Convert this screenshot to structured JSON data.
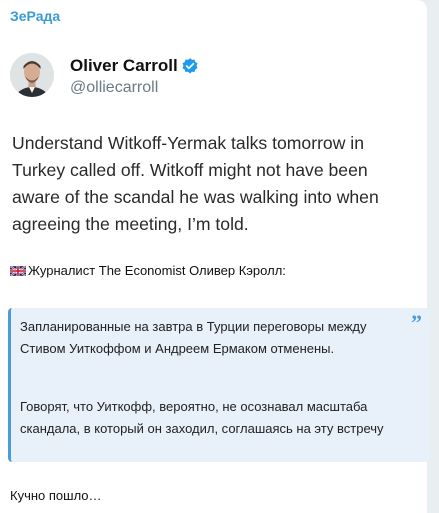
{
  "channel": {
    "name": "ЗеРада"
  },
  "tweet": {
    "author_name": "Oliver Carroll",
    "handle": "@olliecarroll",
    "text": "Understand Witkoff-Yermak talks tomorrow in Turkey called off. Witkoff might not have been aware of the scandal he was walking into when agreeing the meeting, I’m told."
  },
  "post": {
    "intro": "Журналист The Economist Оливер Кэролл:",
    "quote_mark": "”",
    "quote_p1": "Запланированные на завтра в Турции переговоры между Стивом Уиткоффом и Андреем Ермаком отменены.",
    "quote_p2": "Говорят, что Уиткофф, вероятно, не осознавал масштаба скандала, в который он заходил, соглашаясь на эту встречу",
    "footer": "Кучно пошло…"
  },
  "colors": {
    "accent": "#3a9bd5",
    "quote_bg": "#e8f1f9",
    "verified": "#1d9bf0"
  },
  "icons": {
    "verified": "verified-badge-icon",
    "flag": "uk-flag-icon"
  }
}
